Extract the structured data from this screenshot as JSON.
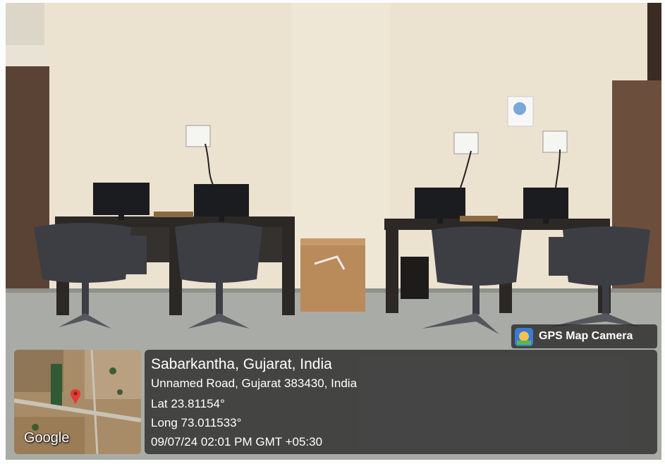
{
  "photo": {
    "description_icons": [
      "monitor-icon",
      "office-chair-icon",
      "cardboard-box-icon",
      "power-socket-icon"
    ]
  },
  "badge": {
    "label": "GPS Map Camera",
    "icon": "gps-map-camera-icon"
  },
  "map": {
    "watermark": "Google",
    "pin_icon": "location-pin-icon"
  },
  "location": {
    "title": "Sabarkantha, Gujarat, India",
    "address": "Unnamed Road, Gujarat 383430, India",
    "lat": "Lat 23.81154°",
    "long": "Long 73.011533°",
    "datetime": "09/07/24 02:01 PM GMT +05:30"
  },
  "colors": {
    "overlay": "#282828",
    "wall": "#ece2d0",
    "floor": "#a9aca6",
    "desk": "#2b2826",
    "pin": "#e53935"
  }
}
